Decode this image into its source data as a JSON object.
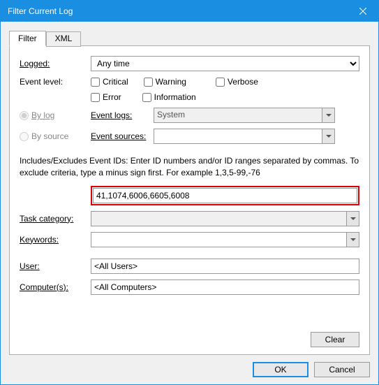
{
  "window": {
    "title": "Filter Current Log"
  },
  "tabs": {
    "filter": "Filter",
    "xml": "XML"
  },
  "form": {
    "logged_label": "Logged:",
    "logged_value": "Any time",
    "eventlevel_label": "Event level:",
    "critical": "Critical",
    "warning": "Warning",
    "verbose": "Verbose",
    "error": "Error",
    "information": "Information",
    "bylog": "By log",
    "bysource": "By source",
    "eventlogs_label": "Event logs:",
    "eventlogs_value": "System",
    "eventsources_label": "Event sources:",
    "eventsources_value": "",
    "desc": "Includes/Excludes Event IDs: Enter ID numbers and/or ID ranges separated by commas. To exclude criteria, type a minus sign first. For example 1,3,5-99,-76",
    "eventids_value": "41,1074,6006,6605,6008",
    "taskcat_label": "Task category:",
    "taskcat_value": "",
    "keywords_label": "Keywords:",
    "keywords_value": "",
    "user_label": "User:",
    "user_value": "<All Users>",
    "computers_label": "Computer(s):",
    "computers_value": "<All Computers>",
    "clear": "Clear"
  },
  "dialog": {
    "ok": "OK",
    "cancel": "Cancel"
  }
}
